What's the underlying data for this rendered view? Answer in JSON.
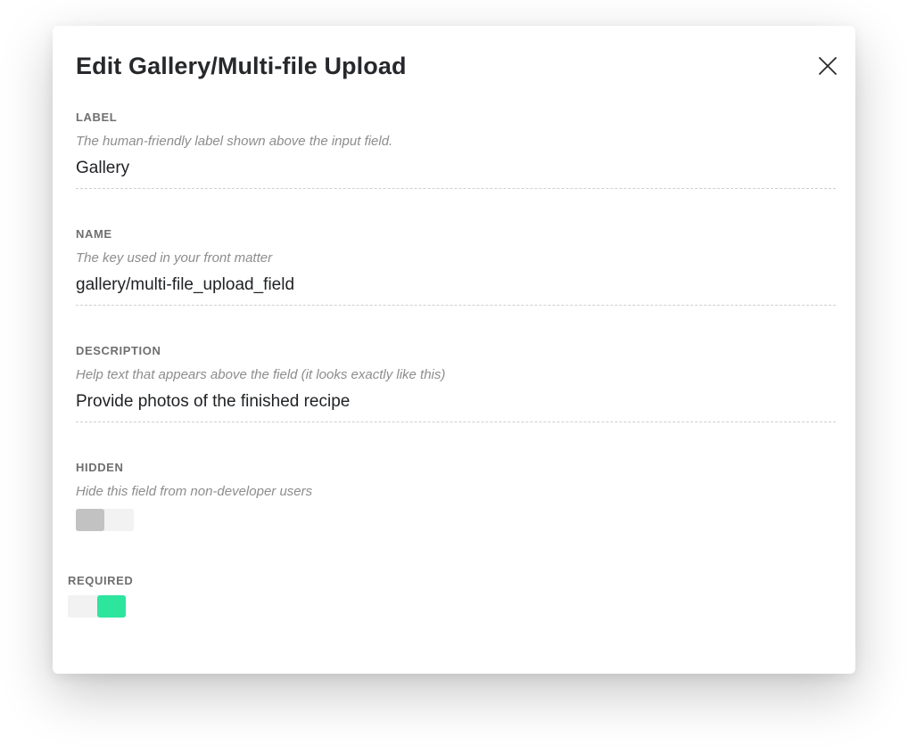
{
  "modal": {
    "title": "Edit Gallery/Multi-file Upload",
    "close_icon": "close-icon"
  },
  "fields": {
    "label": {
      "label": "LABEL",
      "help": "The human-friendly label shown above the input field.",
      "value": "Gallery"
    },
    "name": {
      "label": "NAME",
      "help": "The key used in your front matter",
      "value": "gallery/multi-file_upload_field"
    },
    "description": {
      "label": "DESCRIPTION",
      "help": "Help text that appears above the field (it looks exactly like this)",
      "value": "Provide photos of the finished recipe"
    },
    "hidden": {
      "label": "HIDDEN",
      "help": "Hide this field from non-developer users",
      "enabled": false,
      "knob_color": "#c2c2c2"
    },
    "required": {
      "label": "REQUIRED",
      "enabled": true,
      "knob_color": "#2ee59d"
    }
  }
}
